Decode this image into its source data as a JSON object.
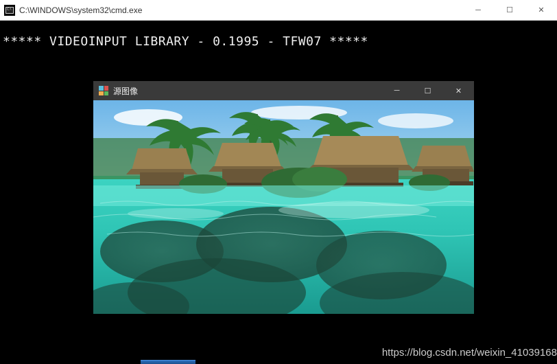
{
  "cmd": {
    "title": "C:\\WINDOWS\\system32\\cmd.exe",
    "output_line": "***** VIDEOINPUT LIBRARY - 0.1995 - TFW07 *****"
  },
  "child": {
    "title": "源图像"
  },
  "watermark": "https://blog.csdn.net/weixin_41039168",
  "icons": {
    "minimize": "─",
    "maximize": "☐",
    "close": "✕"
  }
}
